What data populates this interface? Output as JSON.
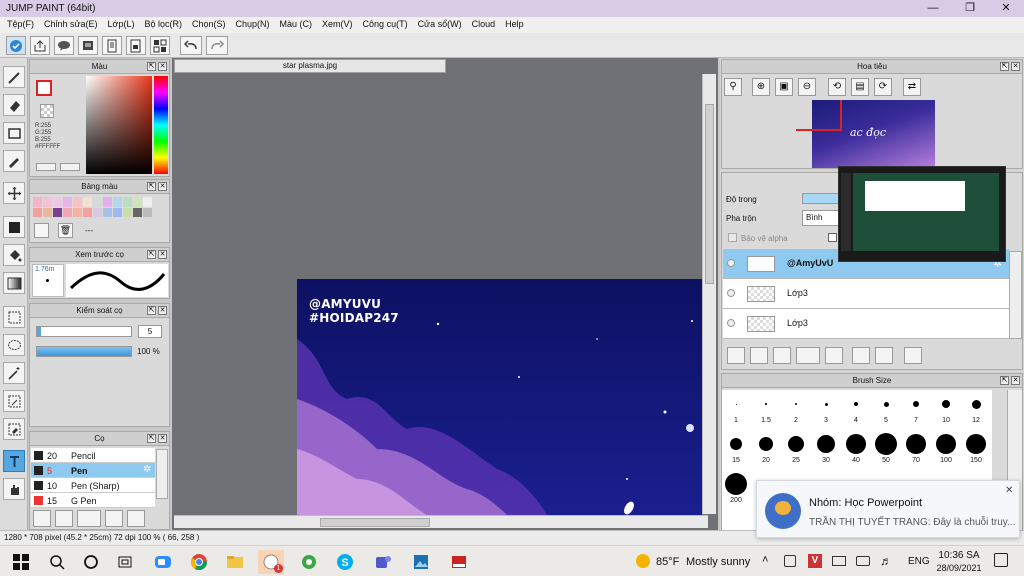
{
  "window": {
    "title": "JUMP PAINT (64bit)"
  },
  "menu": [
    "Tệp(F)",
    "Chỉnh sửa(E)",
    "Lớp(L)",
    "Bộ lọc(R)",
    "Chọn(S)",
    "Chụp(N)",
    "Màu (C)",
    "Xem(V)",
    "Công cụ(T)",
    "Cửa sổ(W)",
    "Cloud",
    "Help"
  ],
  "document": {
    "tab": "star plasma.jpg",
    "watermark_line1": "@AMYUVU",
    "watermark_line2": "#HOIDAP247"
  },
  "panels": {
    "color": {
      "title": "Màu",
      "r": "R:255",
      "g": "G:255",
      "b": "B:255",
      "hex": "#FFFFFF"
    },
    "swatches": {
      "title": "Bảng màu",
      "dash": "---"
    },
    "brush_preview": {
      "title": "Xem trước cọ",
      "size": "1.76m"
    },
    "brush_control": {
      "title": "Kiểm soát cọ",
      "size_value": "5",
      "opacity": "100 %",
      "opacity_fraction": 1.0
    },
    "brushes": {
      "title": "Cọ",
      "items": [
        {
          "size": "20",
          "name": "Pencil",
          "selected": false
        },
        {
          "size": "5",
          "name": "Pen",
          "selected": true
        },
        {
          "size": "10",
          "name": "Pen (Sharp)",
          "selected": false
        },
        {
          "size": "15",
          "name": "G Pen",
          "selected": false
        }
      ]
    },
    "navigator": {
      "title": "Hoa tiêu",
      "thumb_text": "ac đọc"
    },
    "layer": {
      "opacity_label": "Độ trong",
      "blend_label": "Pha trộn",
      "blend_value": "Bình thườ",
      "protect_alpha": "Bảo vệ alpha",
      "layers": [
        {
          "name": "@AmyUvU",
          "active": true
        },
        {
          "name": "Lớp3",
          "active": false
        },
        {
          "name": "Lớp3",
          "active": false
        }
      ]
    },
    "brush_size": {
      "title": "Brush Size",
      "sizes": [
        "1",
        "1.5",
        "2",
        "3",
        "4",
        "5",
        "7",
        "10",
        "12",
        "15",
        "20",
        "25",
        "30",
        "40",
        "50",
        "70",
        "100",
        "150",
        "200"
      ]
    }
  },
  "status": {
    "text": "1280 * 708 pixel   (45.2 * 25cm)   72 dpi   100 %   ( 66, 258 )"
  },
  "notification": {
    "title": "Nhóm: Học Powerpoint",
    "body": "TRẦN THỊ TUYẾT TRANG: Đây là chuỗi truy...",
    "close": "✕"
  },
  "taskbar": {
    "weather_temp": "85°F",
    "weather_text": "Mostly sunny",
    "lang": "ENG",
    "time": "10:36 SA",
    "date": "28/09/2021",
    "badge": "1"
  },
  "colors": {
    "accent": "#57a6e0",
    "sky_top": "#0d1060",
    "sky_bottom": "#5a2fa5"
  }
}
